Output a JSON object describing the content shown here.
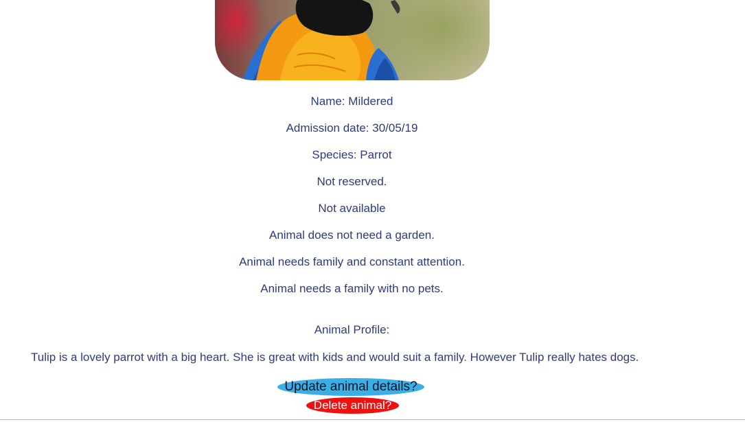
{
  "animal": {
    "photo_alt": "Parrot photo",
    "name_line": "Name: Mildered",
    "admission_line": "Admission date: 30/05/19",
    "species_line": "Species: Parrot",
    "reserved_line": "Not reserved.",
    "available_line": "Not available",
    "garden_line": "Animal does not need a garden.",
    "family_line": "Animal needs family and constant attention.",
    "pets_line": "Animal needs a family with no pets.",
    "profile_heading": "Animal Profile:",
    "profile_text": "Tulip is a lovely parrot with a big heart. She is great with kids and would suit a family. However Tulip really hates dogs."
  },
  "actions": {
    "update_label": "Update animal details?",
    "delete_label": "Delete animal?"
  },
  "colors": {
    "text": "#2e3a7e",
    "update_button": "#3aaee6",
    "delete_button": "#ee1111"
  }
}
